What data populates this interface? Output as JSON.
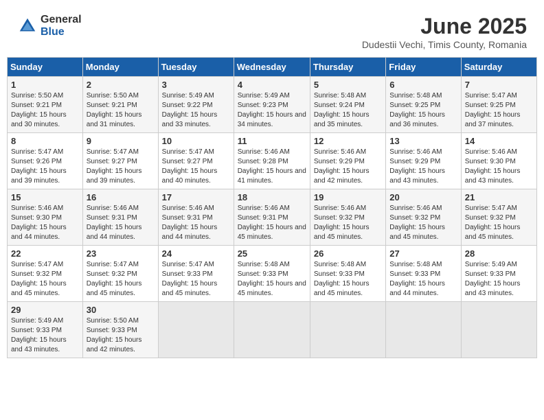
{
  "logo": {
    "general": "General",
    "blue": "Blue"
  },
  "title": "June 2025",
  "location": "Dudestii Vechi, Timis County, Romania",
  "headers": [
    "Sunday",
    "Monday",
    "Tuesday",
    "Wednesday",
    "Thursday",
    "Friday",
    "Saturday"
  ],
  "weeks": [
    [
      {
        "day": "1",
        "sunrise": "Sunrise: 5:50 AM",
        "sunset": "Sunset: 9:21 PM",
        "daylight": "Daylight: 15 hours and 30 minutes."
      },
      {
        "day": "2",
        "sunrise": "Sunrise: 5:50 AM",
        "sunset": "Sunset: 9:21 PM",
        "daylight": "Daylight: 15 hours and 31 minutes."
      },
      {
        "day": "3",
        "sunrise": "Sunrise: 5:49 AM",
        "sunset": "Sunset: 9:22 PM",
        "daylight": "Daylight: 15 hours and 33 minutes."
      },
      {
        "day": "4",
        "sunrise": "Sunrise: 5:49 AM",
        "sunset": "Sunset: 9:23 PM",
        "daylight": "Daylight: 15 hours and 34 minutes."
      },
      {
        "day": "5",
        "sunrise": "Sunrise: 5:48 AM",
        "sunset": "Sunset: 9:24 PM",
        "daylight": "Daylight: 15 hours and 35 minutes."
      },
      {
        "day": "6",
        "sunrise": "Sunrise: 5:48 AM",
        "sunset": "Sunset: 9:25 PM",
        "daylight": "Daylight: 15 hours and 36 minutes."
      },
      {
        "day": "7",
        "sunrise": "Sunrise: 5:47 AM",
        "sunset": "Sunset: 9:25 PM",
        "daylight": "Daylight: 15 hours and 37 minutes."
      }
    ],
    [
      {
        "day": "8",
        "sunrise": "Sunrise: 5:47 AM",
        "sunset": "Sunset: 9:26 PM",
        "daylight": "Daylight: 15 hours and 39 minutes."
      },
      {
        "day": "9",
        "sunrise": "Sunrise: 5:47 AM",
        "sunset": "Sunset: 9:27 PM",
        "daylight": "Daylight: 15 hours and 39 minutes."
      },
      {
        "day": "10",
        "sunrise": "Sunrise: 5:47 AM",
        "sunset": "Sunset: 9:27 PM",
        "daylight": "Daylight: 15 hours and 40 minutes."
      },
      {
        "day": "11",
        "sunrise": "Sunrise: 5:46 AM",
        "sunset": "Sunset: 9:28 PM",
        "daylight": "Daylight: 15 hours and 41 minutes."
      },
      {
        "day": "12",
        "sunrise": "Sunrise: 5:46 AM",
        "sunset": "Sunset: 9:29 PM",
        "daylight": "Daylight: 15 hours and 42 minutes."
      },
      {
        "day": "13",
        "sunrise": "Sunrise: 5:46 AM",
        "sunset": "Sunset: 9:29 PM",
        "daylight": "Daylight: 15 hours and 43 minutes."
      },
      {
        "day": "14",
        "sunrise": "Sunrise: 5:46 AM",
        "sunset": "Sunset: 9:30 PM",
        "daylight": "Daylight: 15 hours and 43 minutes."
      }
    ],
    [
      {
        "day": "15",
        "sunrise": "Sunrise: 5:46 AM",
        "sunset": "Sunset: 9:30 PM",
        "daylight": "Daylight: 15 hours and 44 minutes."
      },
      {
        "day": "16",
        "sunrise": "Sunrise: 5:46 AM",
        "sunset": "Sunset: 9:31 PM",
        "daylight": "Daylight: 15 hours and 44 minutes."
      },
      {
        "day": "17",
        "sunrise": "Sunrise: 5:46 AM",
        "sunset": "Sunset: 9:31 PM",
        "daylight": "Daylight: 15 hours and 44 minutes."
      },
      {
        "day": "18",
        "sunrise": "Sunrise: 5:46 AM",
        "sunset": "Sunset: 9:31 PM",
        "daylight": "Daylight: 15 hours and 45 minutes."
      },
      {
        "day": "19",
        "sunrise": "Sunrise: 5:46 AM",
        "sunset": "Sunset: 9:32 PM",
        "daylight": "Daylight: 15 hours and 45 minutes."
      },
      {
        "day": "20",
        "sunrise": "Sunrise: 5:46 AM",
        "sunset": "Sunset: 9:32 PM",
        "daylight": "Daylight: 15 hours and 45 minutes."
      },
      {
        "day": "21",
        "sunrise": "Sunrise: 5:47 AM",
        "sunset": "Sunset: 9:32 PM",
        "daylight": "Daylight: 15 hours and 45 minutes."
      }
    ],
    [
      {
        "day": "22",
        "sunrise": "Sunrise: 5:47 AM",
        "sunset": "Sunset: 9:32 PM",
        "daylight": "Daylight: 15 hours and 45 minutes."
      },
      {
        "day": "23",
        "sunrise": "Sunrise: 5:47 AM",
        "sunset": "Sunset: 9:32 PM",
        "daylight": "Daylight: 15 hours and 45 minutes."
      },
      {
        "day": "24",
        "sunrise": "Sunrise: 5:47 AM",
        "sunset": "Sunset: 9:33 PM",
        "daylight": "Daylight: 15 hours and 45 minutes."
      },
      {
        "day": "25",
        "sunrise": "Sunrise: 5:48 AM",
        "sunset": "Sunset: 9:33 PM",
        "daylight": "Daylight: 15 hours and 45 minutes."
      },
      {
        "day": "26",
        "sunrise": "Sunrise: 5:48 AM",
        "sunset": "Sunset: 9:33 PM",
        "daylight": "Daylight: 15 hours and 45 minutes."
      },
      {
        "day": "27",
        "sunrise": "Sunrise: 5:48 AM",
        "sunset": "Sunset: 9:33 PM",
        "daylight": "Daylight: 15 hours and 44 minutes."
      },
      {
        "day": "28",
        "sunrise": "Sunrise: 5:49 AM",
        "sunset": "Sunset: 9:33 PM",
        "daylight": "Daylight: 15 hours and 43 minutes."
      }
    ],
    [
      {
        "day": "29",
        "sunrise": "Sunrise: 5:49 AM",
        "sunset": "Sunset: 9:33 PM",
        "daylight": "Daylight: 15 hours and 43 minutes."
      },
      {
        "day": "30",
        "sunrise": "Sunrise: 5:50 AM",
        "sunset": "Sunset: 9:33 PM",
        "daylight": "Daylight: 15 hours and 42 minutes."
      },
      null,
      null,
      null,
      null,
      null
    ]
  ]
}
